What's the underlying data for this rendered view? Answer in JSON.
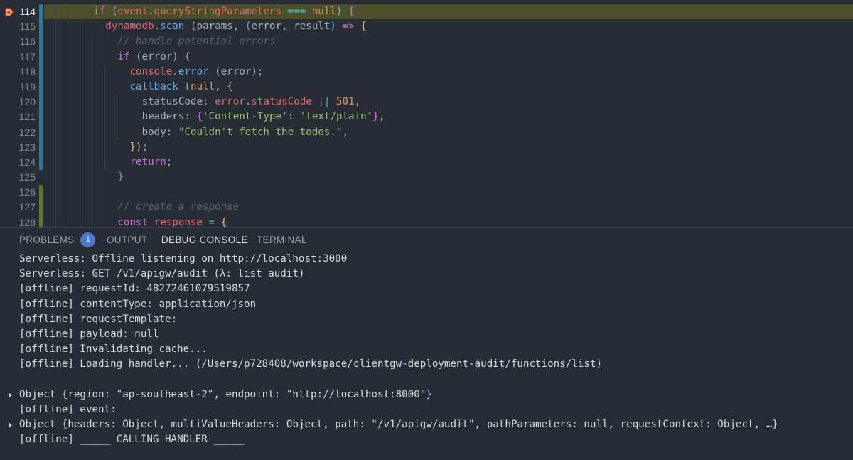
{
  "editor": {
    "lines": [
      {
        "num": "114",
        "indent": 3,
        "breakpoint": true,
        "highlight": true,
        "diff": "mod",
        "tokens": [
          [
            "if",
            "kw"
          ],
          [
            " (",
            "pun"
          ],
          [
            "event",
            "var"
          ],
          [
            ".",
            "pun"
          ],
          [
            "queryStringParameters",
            "var"
          ],
          [
            " === ",
            "op"
          ],
          [
            "null",
            "num"
          ],
          [
            ") ",
            "pun"
          ],
          [
            "{",
            "br2"
          ]
        ]
      },
      {
        "num": "115",
        "indent": 4,
        "diff": "mod",
        "tokens": [
          [
            "dynamodb",
            "var"
          ],
          [
            ".",
            "pun"
          ],
          [
            "scan",
            "fn"
          ],
          [
            " (params, ",
            "pun"
          ],
          [
            "(",
            "br3"
          ],
          [
            "error, result",
            "pun"
          ],
          [
            ")",
            "br3"
          ],
          [
            " => ",
            "kw"
          ],
          [
            "{",
            "br1"
          ]
        ]
      },
      {
        "num": "116",
        "indent": 5,
        "diff": "mod",
        "tokens": [
          [
            "// handle potential errors",
            "com"
          ]
        ]
      },
      {
        "num": "117",
        "indent": 5,
        "diff": "mod",
        "tokens": [
          [
            "if",
            "kw"
          ],
          [
            " (error) ",
            "pun"
          ],
          [
            "{",
            "br2"
          ]
        ]
      },
      {
        "num": "118",
        "indent": 6,
        "diff": "mod",
        "tokens": [
          [
            "console",
            "var"
          ],
          [
            ".",
            "pun"
          ],
          [
            "error",
            "fn"
          ],
          [
            " (error);",
            "pun"
          ]
        ]
      },
      {
        "num": "119",
        "indent": 6,
        "diff": "mod",
        "tokens": [
          [
            "callback",
            "fn"
          ],
          [
            " (",
            "pun"
          ],
          [
            "null",
            "num"
          ],
          [
            ", ",
            "pun"
          ],
          [
            "{",
            "br1"
          ]
        ]
      },
      {
        "num": "120",
        "indent": 7,
        "diff": "mod",
        "tokens": [
          [
            "statusCode: ",
            "pun"
          ],
          [
            "error",
            "var"
          ],
          [
            ".",
            "pun"
          ],
          [
            "statusCode",
            "var"
          ],
          [
            " || ",
            "op"
          ],
          [
            "501",
            "num"
          ],
          [
            ",",
            "pun"
          ]
        ]
      },
      {
        "num": "121",
        "indent": 7,
        "diff": "mod",
        "tokens": [
          [
            "headers: ",
            "pun"
          ],
          [
            "{",
            "br2"
          ],
          [
            "'Content-Type'",
            "str"
          ],
          [
            ": ",
            "pun"
          ],
          [
            "'text/plain'",
            "str"
          ],
          [
            "}",
            "br2"
          ],
          [
            ",",
            "pun"
          ]
        ]
      },
      {
        "num": "122",
        "indent": 7,
        "diff": "mod",
        "tokens": [
          [
            "body: ",
            "pun"
          ],
          [
            "\"Couldn't fetch the todos.\"",
            "str"
          ],
          [
            ",",
            "pun"
          ]
        ]
      },
      {
        "num": "123",
        "indent": 6,
        "diff": "mod",
        "tokens": [
          [
            "}",
            "br1"
          ],
          [
            ");",
            "pun"
          ]
        ]
      },
      {
        "num": "124",
        "indent": 6,
        "diff": "mod",
        "tokens": [
          [
            "return",
            "kw"
          ],
          [
            ";",
            "pun"
          ]
        ]
      },
      {
        "num": "125",
        "indent": 5,
        "tokens": [
          [
            "}",
            "br2"
          ]
        ]
      },
      {
        "num": "126",
        "indent": 5,
        "diff": "add",
        "tokens": []
      },
      {
        "num": "127",
        "indent": 5,
        "diff": "add",
        "tokens": [
          [
            "// create a response",
            "com"
          ]
        ]
      },
      {
        "num": "128",
        "indent": 5,
        "diff": "add",
        "tokens": [
          [
            "const",
            "kw"
          ],
          [
            " ",
            "pun"
          ],
          [
            "response",
            "var"
          ],
          [
            " = ",
            "op"
          ],
          [
            "{",
            "br1"
          ]
        ]
      }
    ]
  },
  "panel": {
    "tabs": [
      {
        "label": "PROBLEMS",
        "badge": "1",
        "active": false
      },
      {
        "label": "OUTPUT",
        "active": false
      },
      {
        "label": "DEBUG CONSOLE",
        "active": true
      },
      {
        "label": "TERMINAL",
        "active": false
      }
    ],
    "console_lines": [
      {
        "text": "Serverless: Offline listening on http://localhost:3000"
      },
      {
        "text": "Serverless: GET /v1/apigw/audit (λ: list_audit)"
      },
      {
        "text": "[offline] requestId: 48272461079519857"
      },
      {
        "text": "[offline] contentType: application/json"
      },
      {
        "text": "[offline] requestTemplate:"
      },
      {
        "text": "[offline] payload: null"
      },
      {
        "text": "[offline] Invalidating cache..."
      },
      {
        "text": "[offline] Loading handler... (/Users/p728408/workspace/clientgw-deployment-audit/functions/list)"
      },
      {
        "text": ""
      },
      {
        "text": "Object {region: \"ap-southeast-2\", endpoint: \"http://localhost:8000\"}",
        "expandable": true
      },
      {
        "text": "[offline] event:"
      },
      {
        "text": "Object {headers: Object, multiValueHeaders: Object, path: \"/v1/apigw/audit\", pathParameters: null, requestContext: Object, …}",
        "expandable": true
      },
      {
        "text": "[offline] _____ CALLING HANDLER _____"
      }
    ]
  },
  "colors": {
    "background": "#282c34",
    "breakpoint": "#e5c07b",
    "current_line": "#4b4f2a",
    "badge": "#4d78cc",
    "diff_modified": "#1d7f9e",
    "diff_added": "#5c7c1c"
  },
  "icons": {
    "breakpoint": "breakpoint-arrow-icon",
    "expand": "expand-arrow-icon"
  }
}
